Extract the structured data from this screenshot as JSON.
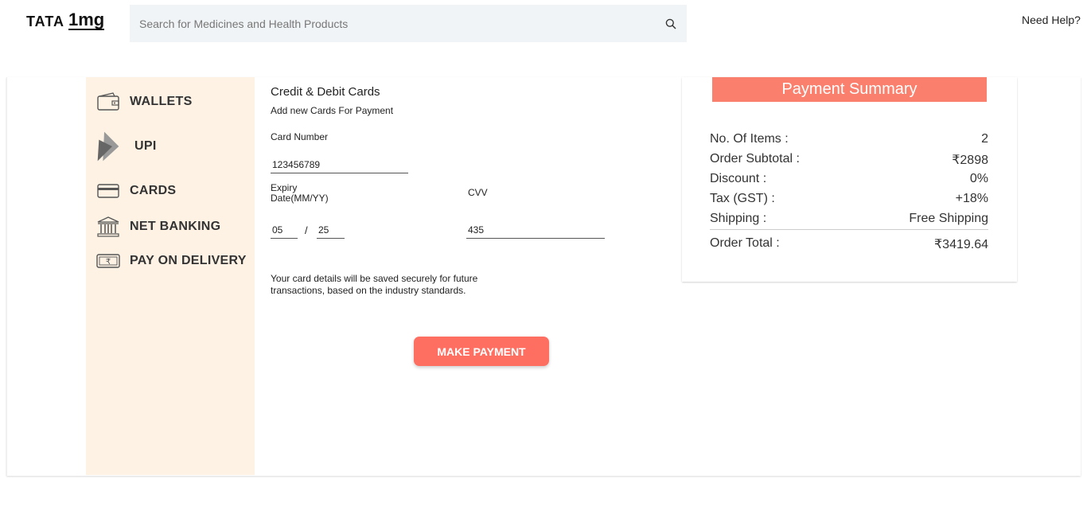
{
  "header": {
    "logo": {
      "tata": "TATA",
      "onemg": "1mg"
    },
    "search_placeholder": "Search for Medicines and Health Products",
    "need_help": "Need Help?"
  },
  "sidebar": {
    "items": [
      {
        "label": "WALLETS",
        "icon": "wallet-icon"
      },
      {
        "label": "UPI",
        "icon": "upi-icon"
      },
      {
        "label": "CARDS",
        "icon": "card-icon"
      },
      {
        "label": "NET BANKING",
        "icon": "bank-icon"
      },
      {
        "label": "PAY ON DELIVERY",
        "icon": "cash-icon"
      }
    ]
  },
  "form": {
    "title": "Credit & Debit Cards",
    "subtitle": "Add new Cards For Payment",
    "card_number_label": "Card Number",
    "card_number": "123456789",
    "expiry_label_1": "Expiry",
    "expiry_label_2": "Date(MM/YY)",
    "expiry_month": "05",
    "expiry_separator": "/",
    "expiry_year": "25",
    "cvv_label": "CVV",
    "cvv": "435",
    "note": "Your card details will be saved securely for future transactions, based on the industry standards.",
    "button": "MAKE PAYMENT"
  },
  "summary": {
    "title": "Payment Summary",
    "rows": [
      {
        "label": "No. Of Items :",
        "value": "2"
      },
      {
        "label": "Order Subtotal :",
        "value": "₹2898"
      },
      {
        "label": "Discount :",
        "value": "0%"
      },
      {
        "label": "Tax (GST) :",
        "value": "+18%"
      },
      {
        "label": "Shipping :",
        "value": "Free Shipping"
      }
    ],
    "total": {
      "label": "Order Total :",
      "value": "₹3419.64"
    }
  },
  "colors": {
    "accent": "#ff6f61",
    "summary_header": "#fa7f6c",
    "sidebar_bg": "#fdf2e4",
    "search_bg": "#f1f4f6"
  }
}
